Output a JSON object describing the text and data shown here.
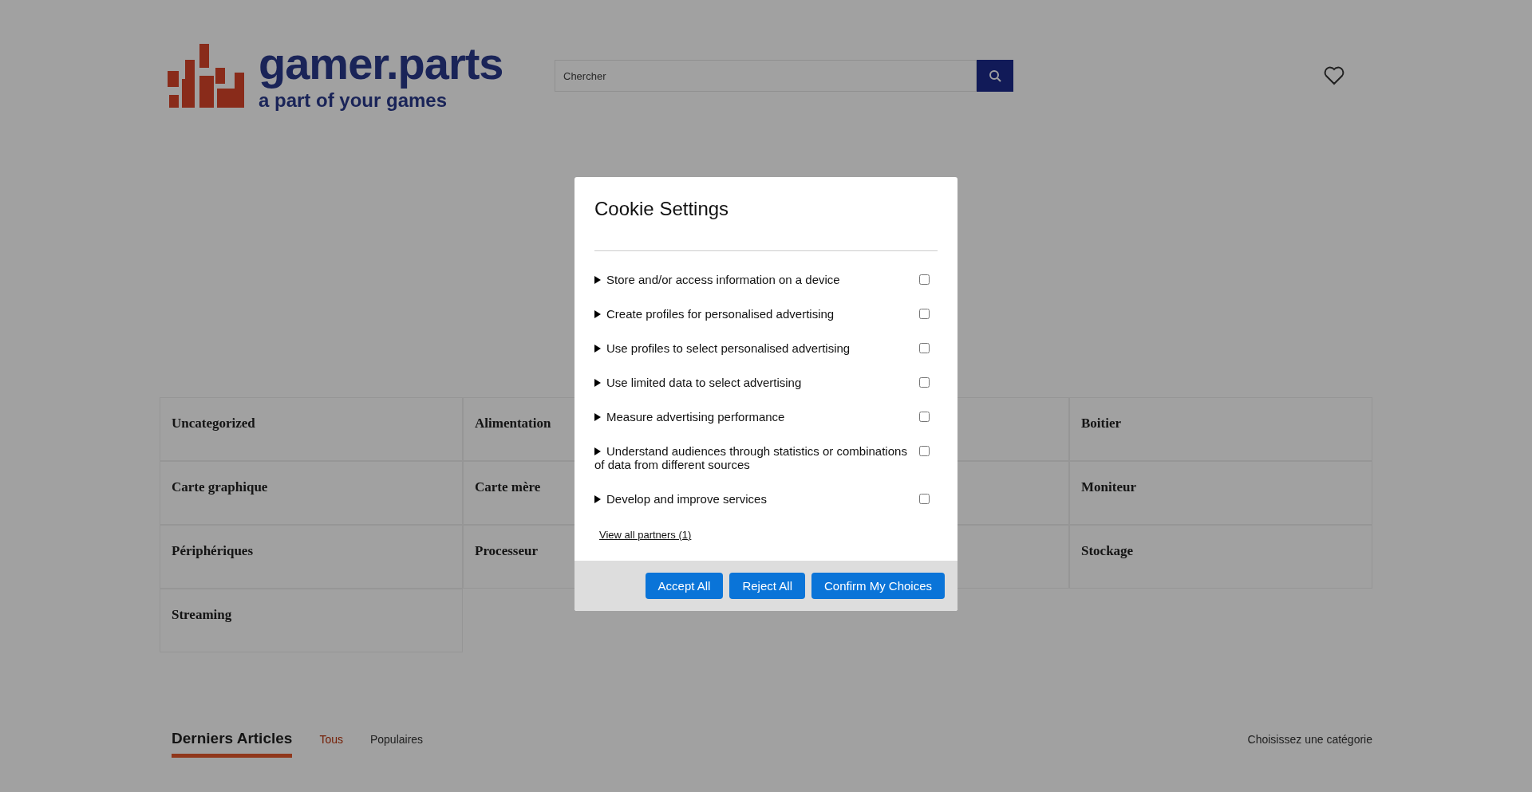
{
  "header": {
    "logo": {
      "name": "gamer.parts",
      "tagline": "a part of your games"
    },
    "search": {
      "placeholder": "Chercher"
    }
  },
  "categories": [
    {
      "kind": "category",
      "title": "Uncategorized"
    },
    {
      "kind": "category",
      "title": "Alimentation"
    },
    {
      "kind": "covered"
    },
    {
      "kind": "category",
      "title": "Boitier"
    },
    {
      "kind": "category",
      "title": "Carte graphique"
    },
    {
      "kind": "category",
      "title": "Carte mère"
    },
    {
      "kind": "covered"
    },
    {
      "kind": "category",
      "title": "Moniteur"
    },
    {
      "kind": "category",
      "title": "Périphériques"
    },
    {
      "kind": "category",
      "title": "Processeur"
    },
    {
      "kind": "covered"
    },
    {
      "kind": "category",
      "title": "Stockage"
    },
    {
      "kind": "category",
      "title": "Streaming"
    }
  ],
  "articles": {
    "heading": "Derniers Articles",
    "tabs": [
      {
        "label": "Tous",
        "selected": true
      },
      {
        "label": "Populaires",
        "selected": false
      }
    ],
    "category_select": "Choisissez une catégorie"
  },
  "dialog": {
    "title": "Cookie Settings",
    "purposes": [
      {
        "label": "Store and/or access information on a device",
        "checked": false,
        "expanded": false
      },
      {
        "label": "Create profiles for personalised advertising",
        "checked": false,
        "expanded": false
      },
      {
        "label": "Use profiles to select personalised advertising",
        "checked": false,
        "expanded": false
      },
      {
        "label": "Use limited data to select advertising",
        "checked": false,
        "expanded": false
      },
      {
        "label": "Measure advertising performance",
        "checked": false,
        "expanded": false
      },
      {
        "label": "Understand audiences through statistics or combinations of data from different sources",
        "checked": false,
        "expanded": false
      },
      {
        "label": "Develop and improve services",
        "checked": false,
        "expanded": false
      }
    ],
    "partners_link": "View all partners (1)",
    "buttons": [
      "Accept All",
      "Reject All",
      "Confirm My Choices"
    ]
  }
}
